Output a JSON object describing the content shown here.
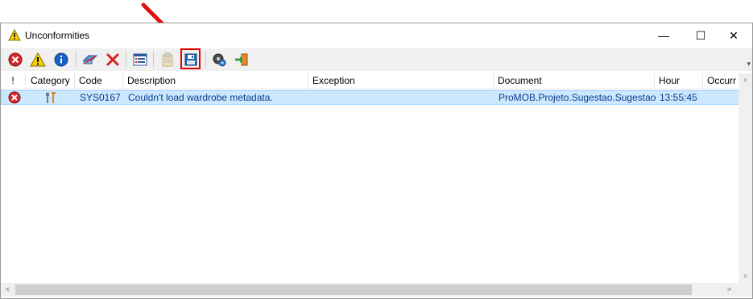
{
  "window": {
    "title": "Unconformities",
    "minimize_glyph": "—",
    "maximize_glyph": "☐",
    "close_glyph": "✕"
  },
  "toolbar": {
    "buttons": [
      {
        "name": "show-errors-button",
        "icon": "error-icon"
      },
      {
        "name": "show-warnings-button",
        "icon": "warning-icon"
      },
      {
        "name": "show-info-button",
        "icon": "info-icon"
      },
      {
        "name": "clear-filter-button",
        "icon": "eraser-icon"
      },
      {
        "name": "delete-button",
        "icon": "delete-x-icon"
      },
      {
        "name": "details-button",
        "icon": "list-details-icon"
      },
      {
        "name": "copy-button",
        "icon": "clipboard-icon"
      },
      {
        "name": "save-button",
        "icon": "floppy-disk-icon"
      },
      {
        "name": "refresh-button",
        "icon": "gear-refresh-icon"
      },
      {
        "name": "exit-button",
        "icon": "exit-door-icon"
      }
    ],
    "overflow_glyph": "▾"
  },
  "table": {
    "columns": [
      "!",
      "Category",
      "Code",
      "Description",
      "Exception",
      "Document",
      "Hour",
      "Occurr"
    ],
    "rows": [
      {
        "severity_icon": "error-icon",
        "category_icon": "tools-icon",
        "code": "SYS0167",
        "description": "Couldn't load wardrobe metadata.",
        "exception": "",
        "document": "ProMOB.Projeto.Sugestao.Sugestao",
        "hour": "13:55:45",
        "occurrences": ""
      }
    ]
  },
  "scrollbars": {
    "up_glyph": "∧",
    "down_glyph": "∨",
    "left_glyph": "<",
    "right_glyph": ">"
  },
  "colors": {
    "selection": "#cce8ff",
    "annotation_red": "#e00000"
  }
}
